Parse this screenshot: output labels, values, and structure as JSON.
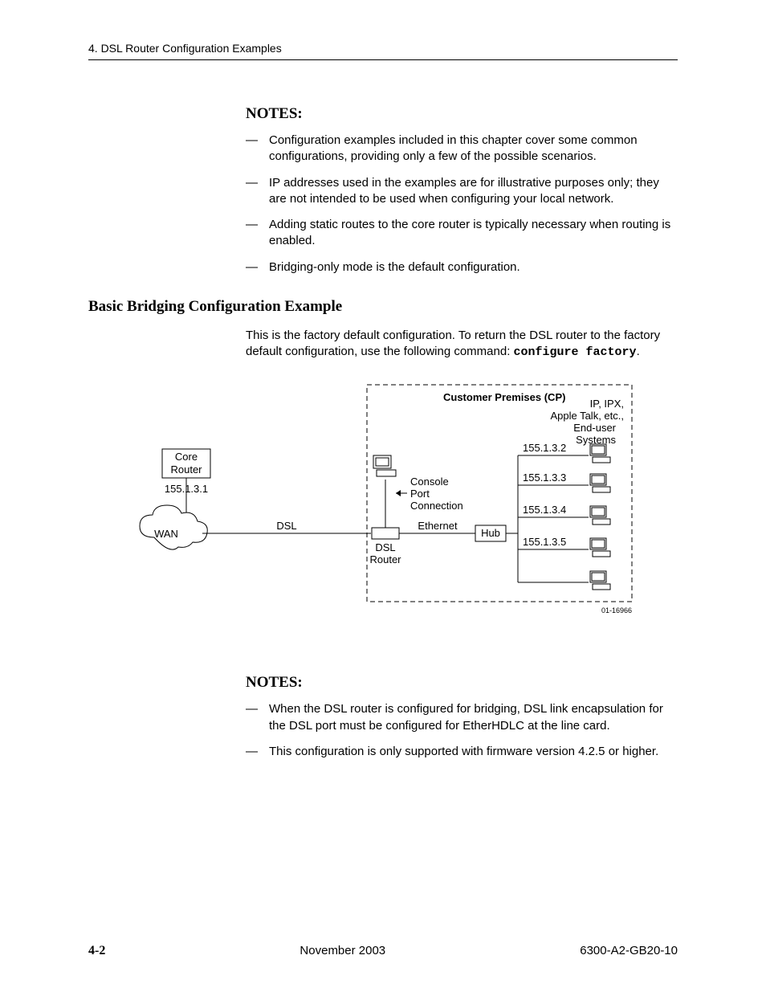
{
  "header": {
    "running_title": "4. DSL Router Configuration Examples"
  },
  "notes_top": {
    "heading": "NOTES:",
    "items": [
      "Configuration examples included in this chapter cover some common configurations, providing only a few of the possible scenarios.",
      "IP addresses used in the examples are for illustrative purposes only; they are not intended to be used when configuring your local network.",
      "Adding static routes to the core router is typically necessary when routing is enabled.",
      "Bridging-only mode is the default configuration."
    ]
  },
  "section": {
    "heading": "Basic Bridging Configuration Example",
    "intro_a": "This is the factory default configuration. To return the DSL router to the factory default configuration, use the following command: ",
    "command": "configure factory",
    "intro_b": "."
  },
  "diagram": {
    "cp_label": "Customer Premises (CP)",
    "end_user_line1": "IP, IPX,",
    "end_user_line2": "Apple Talk, etc.,",
    "end_user_line3": "End-user",
    "end_user_line4": "Systems",
    "core_router_line1": "Core",
    "core_router_line2": "Router",
    "core_ip": "155.1.3.1",
    "wan": "WAN",
    "dsl": "DSL",
    "dsl_router_line1": "DSL",
    "dsl_router_line2": "Router",
    "console_line1": "Console",
    "console_line2": "Port",
    "console_line3": "Connection",
    "ethernet": "Ethernet",
    "hub": "Hub",
    "ips": [
      "155.1.3.2",
      "155.1.3.3",
      "155.1.3.4",
      "155.1.3.5"
    ],
    "figure_id": "01-16966"
  },
  "notes_bottom": {
    "heading": "NOTES:",
    "items": [
      "When the DSL router is configured for bridging, DSL link encapsulation for the DSL port must be configured for EtherHDLC at the line card.",
      "This configuration is only supported with firmware version 4.2.5 or higher."
    ]
  },
  "footer": {
    "page": "4-2",
    "date": "November 2003",
    "doc": "6300-A2-GB20-10"
  }
}
